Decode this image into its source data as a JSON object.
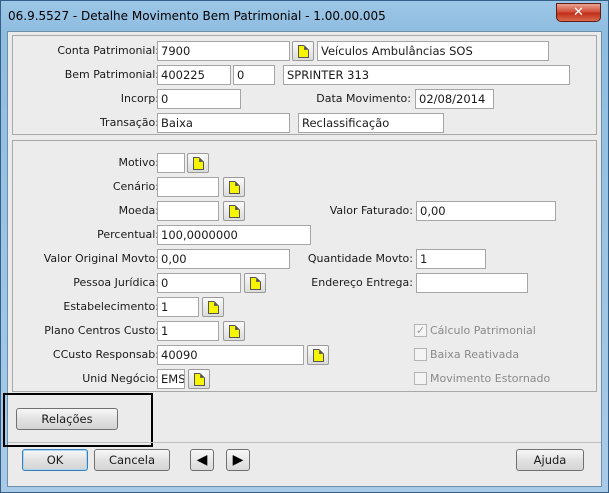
{
  "window": {
    "title": "06.9.5527 - Detalhe Movimento Bem Patrimonial - 1.00.00.005",
    "close_glyph": "✕"
  },
  "header": {
    "conta_patrimonial": {
      "label": "Conta Patrimonial:",
      "code": "7900",
      "description": "Veículos Ambulâncias SOS"
    },
    "bem_patrimonial": {
      "label": "Bem Patrimonial:",
      "code": "400225",
      "seq": "0",
      "description": "SPRINTER 313"
    },
    "incorp": {
      "label": "Incorp:",
      "value": "0"
    },
    "data_movimento": {
      "label": "Data Movimento:",
      "value": "02/08/2014"
    },
    "transacao": {
      "label": "Transação:",
      "value": "Baixa",
      "type": "Reclassificação"
    }
  },
  "detail": {
    "motivo": {
      "label": "Motivo:",
      "value": ""
    },
    "cenario": {
      "label": "Cenário:",
      "value": ""
    },
    "moeda": {
      "label": "Moeda:",
      "value": ""
    },
    "valor_faturado": {
      "label": "Valor Faturado:",
      "value": "0,00"
    },
    "percentual": {
      "label": "Percentual:",
      "value": "100,0000000"
    },
    "valor_original": {
      "label": "Valor Original Movto:",
      "value": "0,00"
    },
    "quantidade": {
      "label": "Quantidade Movto:",
      "value": "1"
    },
    "pessoa_juridica": {
      "label": "Pessoa Jurídica:",
      "value": "0"
    },
    "endereco_entrega": {
      "label": "Endereço Entrega:",
      "value": ""
    },
    "estabelecimento": {
      "label": "Estabelecimento:",
      "value": "1"
    },
    "plano_centros": {
      "label": "Plano Centros Custo:",
      "value": "1"
    },
    "ccusto": {
      "label": "CCusto Responsab:",
      "value": "40090"
    },
    "unid_negocio": {
      "label": "Unid Negócio:",
      "value": "EMS"
    },
    "checks": {
      "calculo": {
        "label": "Cálculo Patrimonial",
        "checked": true,
        "mark": "✓"
      },
      "baixa_reativada": {
        "label": "Baixa Reativada",
        "checked": false
      },
      "movimento_estornado": {
        "label": "Movimento Estornado",
        "checked": false
      }
    }
  },
  "buttons": {
    "relacoes": "Relações",
    "ok": "OK",
    "cancela": "Cancela",
    "prev": "◀",
    "next": "▶",
    "ajuda": "Ajuda"
  },
  "icons": {
    "zoom": "yellow-document-icon"
  }
}
